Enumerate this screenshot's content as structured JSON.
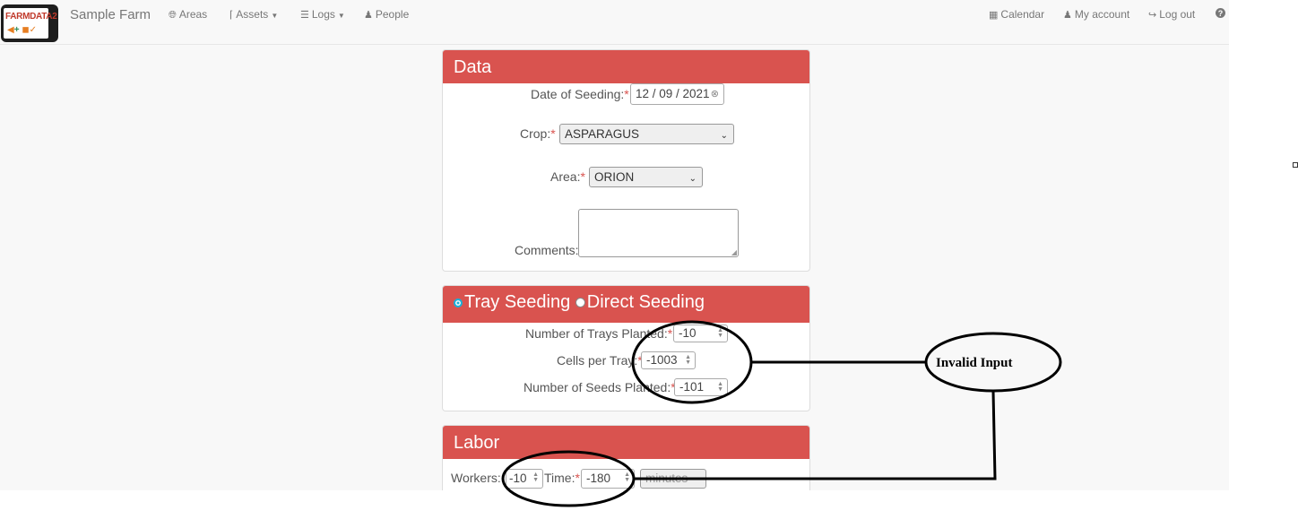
{
  "navbar": {
    "logo_text": "FARMDATA2",
    "site_name": "Sample Farm",
    "areas": "Areas",
    "assets": "Assets",
    "logs": "Logs",
    "people": "People",
    "calendar": "Calendar",
    "my_account": "My account",
    "log_out": "Log out"
  },
  "data_panel": {
    "heading": "Data",
    "date_label": "Date of Seeding:",
    "date_value": "12 / 09 / 2021",
    "crop_label": "Crop:",
    "crop_value": "ASPARAGUS",
    "area_label": "Area:",
    "area_value": "ORION",
    "comments_label": "Comments:",
    "comments_value": ""
  },
  "seeding_panel": {
    "tray_label": "Tray Seeding",
    "direct_label": "Direct Seeding",
    "selected": "Tray Seeding",
    "trays_label": "Number of Trays Planted:",
    "trays_value": "-10",
    "cells_label": "Cells per Tray:",
    "cells_value": "-1003",
    "seeds_label": "Number of Seeds Planted:",
    "seeds_value": "-101"
  },
  "labor_panel": {
    "heading": "Labor",
    "workers_label": "Workers:",
    "workers_value": "-10",
    "time_label": "Time:",
    "time_value": "-180",
    "unit_value": "minutes"
  },
  "annotation": {
    "text": "Invalid Input"
  },
  "colors": {
    "panel_heading": "#d9534f",
    "required_star": "#d9534f",
    "radio_selected": "#1ab0d8"
  }
}
